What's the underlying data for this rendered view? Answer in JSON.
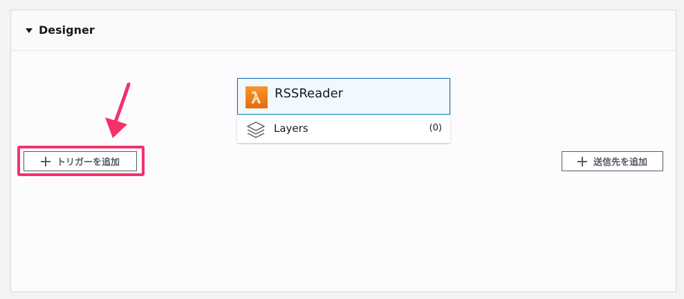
{
  "designer": {
    "title": "Designer"
  },
  "function": {
    "name": "RSSReader",
    "icon": "lambda-icon"
  },
  "layers": {
    "label": "Layers",
    "count": "(0)",
    "icon": "layers-icon"
  },
  "buttons": {
    "add_trigger": "トリガーを追加",
    "add_destination": "送信先を追加"
  },
  "colors": {
    "highlight": "#f5306a",
    "lambda_orange": "#ec7211",
    "selected_border": "#0073bb"
  }
}
